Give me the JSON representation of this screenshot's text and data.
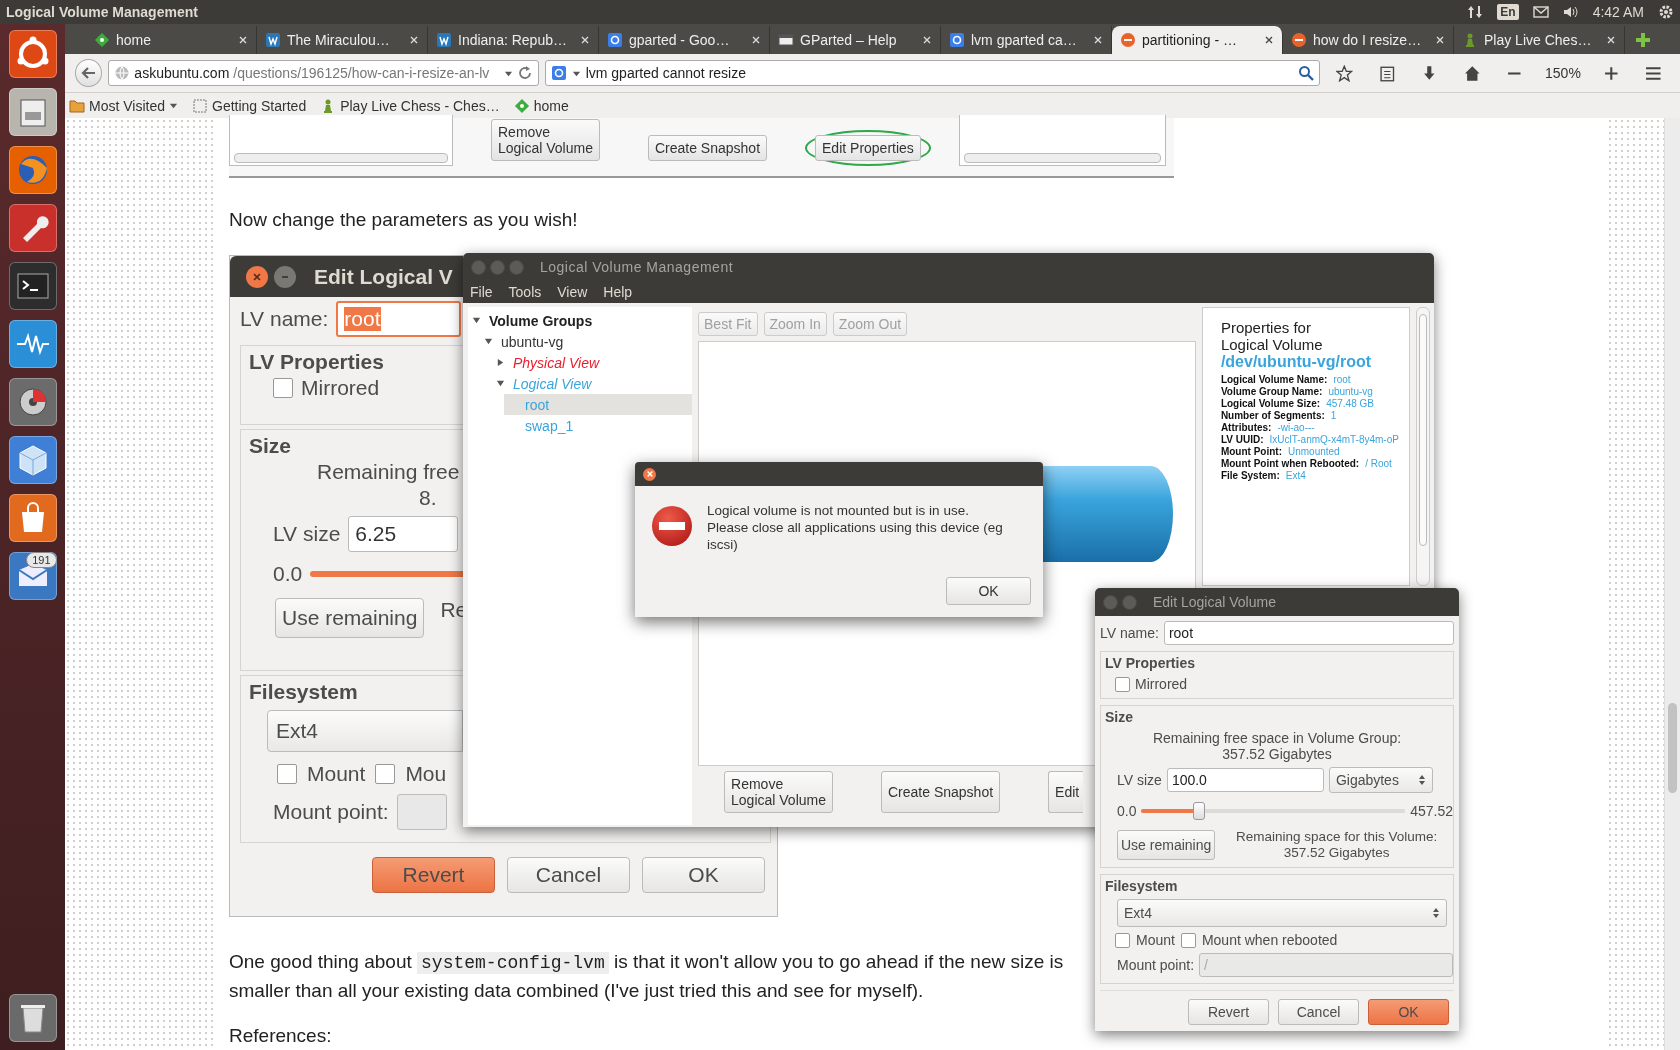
{
  "top_panel": {
    "title": "Logical Volume Management",
    "keyboard_layout": "En",
    "clock": "4:42 AM"
  },
  "launcher": {
    "mail_badge": "191"
  },
  "browser": {
    "tabs": [
      {
        "label": "home",
        "kind": "diamond",
        "selected": false
      },
      {
        "label": "The Miraculou…",
        "kind": "w-badge",
        "selected": false
      },
      {
        "label": "Indiana: Repub…",
        "kind": "w-badge",
        "selected": false
      },
      {
        "label": "gparted - Goo…",
        "kind": "g-badge",
        "selected": false
      },
      {
        "label": "GParted – Help",
        "kind": "window",
        "selected": false
      },
      {
        "label": "lvm gparted ca…",
        "kind": "g-badge",
        "selected": false
      },
      {
        "label": "partitioning - …",
        "kind": "bubble",
        "selected": true
      },
      {
        "label": "how do I resize…",
        "kind": "bubble",
        "selected": false
      },
      {
        "label": "Play Live Ches…",
        "kind": "pawn",
        "selected": false
      }
    ],
    "address": {
      "host": "askubuntu.com",
      "path": "/questions/196125/how-can-i-resize-an-lv"
    },
    "search": {
      "value": "lvm gparted cannot resize"
    },
    "zoom_level": "150%",
    "bookmarks": [
      {
        "label": "Most Visited",
        "kind": "folder-menu"
      },
      {
        "label": "Getting Started",
        "kind": "page"
      },
      {
        "label": "Play Live Chess - Ches…",
        "kind": "pawn"
      },
      {
        "label": "home",
        "kind": "diamond"
      }
    ]
  },
  "page": {
    "top_image": {
      "buttons": [
        {
          "label": "Remove\nLogical Volume",
          "circled": false
        },
        {
          "label": "Create Snapshot",
          "circled": false
        },
        {
          "label": "Edit Properties",
          "circled": true
        }
      ]
    },
    "intro": "Now change the parameters as you wish!",
    "screenshot": {
      "title": "Edit Logical V",
      "lv_name_label": "LV name:",
      "lv_name": "root",
      "properties_title": "LV Properties",
      "mirrored": {
        "label": "Mirrored",
        "checked": false
      },
      "size_title": "Size",
      "remaining": "Remaining free",
      "remaining_value": "8.",
      "lv_size_label": "LV size",
      "lv_size": "6.25",
      "min": "0.0",
      "use_remaining": "Use remaining",
      "remaining_volume": "Re",
      "filesystem_title": "Filesystem",
      "filesystem": "Ext4",
      "mount": {
        "label": "Mount",
        "checked": false
      },
      "mount_rebooted": {
        "label": "Mou",
        "checked": false
      },
      "mount_point_label": "Mount point:",
      "buttons": [
        {
          "label": "Revert",
          "default": true
        },
        {
          "label": "Cancel",
          "default": false
        },
        {
          "label": "OK",
          "default": false
        }
      ]
    },
    "paragraph": {
      "before": "One good thing about ",
      "code": "system-config-lvm",
      "after": " is that it won't allow you to go ahead if the new size is smaller than all your existing data combined (I've just tried this and see for myself)."
    },
    "references_heading": "References:"
  },
  "lvm_window": {
    "title": "Logical Volume Management",
    "menu": [
      "File",
      "Tools",
      "View",
      "Help"
    ],
    "tree": [
      {
        "label": "Volume Groups",
        "kind": "heading",
        "expanded": true,
        "selected": false,
        "children": [
          {
            "label": "ubuntu-vg",
            "kind": "group",
            "expanded": true,
            "selected": false,
            "children": [
              {
                "label": "Physical View",
                "kind": "physical",
                "expanded": false,
                "selected": false
              },
              {
                "label": "Logical View",
                "kind": "logical",
                "expanded": true,
                "selected": false,
                "children": [
                  {
                    "label": "root",
                    "kind": "volume",
                    "selected": true
                  },
                  {
                    "label": "swap_1",
                    "kind": "volume",
                    "selected": false
                  }
                ]
              }
            ]
          }
        ]
      }
    ],
    "toolbar": [
      {
        "label": "Best Fit",
        "disabled": true
      },
      {
        "label": "Zoom In",
        "disabled": true
      },
      {
        "label": "Zoom Out",
        "disabled": true
      }
    ],
    "properties": {
      "heading": "Properties for\nLogical Volume",
      "path": "/dev/ubuntu-vg/root",
      "fields": [
        {
          "label": "Logical Volume Name:",
          "value": "root"
        },
        {
          "label": "Volume Group Name:",
          "value": "ubuntu-vg"
        },
        {
          "label": "Logical Volume Size:",
          "value": "457.48 GB"
        },
        {
          "label": "Number of Segments:",
          "value": "1"
        },
        {
          "label": "Attributes:",
          "value": "-wi-ao---"
        },
        {
          "label": "LV UUID:",
          "value": "IxUclT-anmQ-x4mT-8y4m-oP"
        },
        {
          "label": "Mount Point:",
          "value": "Unmounted"
        },
        {
          "label": "Mount Point when Rebooted:",
          "value": "/  Root"
        },
        {
          "label": "File System:",
          "value": "Ext4"
        }
      ]
    },
    "buttons": [
      "Remove\nLogical Volume",
      "Create Snapshot",
      "Edit"
    ]
  },
  "error_dialog": {
    "message": "Logical volume is not mounted but is in use.\nPlease close all applications using this device (eg\niscsi)",
    "button": "OK"
  },
  "edit_dialog": {
    "title": "Edit Logical Volume",
    "lv_name_label": "LV name:",
    "lv_name": "root",
    "properties_title": "LV Properties",
    "mirrored": {
      "label": "Mirrored",
      "checked": false
    },
    "size_title": "Size",
    "remaining": "Remaining free space in Volume Group:\n357.52 Gigabytes",
    "lv_size_label": "LV size",
    "lv_size": "100.0",
    "unit": "Gigabytes",
    "min": "0.0",
    "max": "457.52",
    "level": 0.2186,
    "use_remaining": "Use remaining",
    "remaining_volume": "Remaining space for this Volume:\n357.52 Gigabytes",
    "filesystem_title": "Filesystem",
    "filesystem": "Ext4",
    "mount": {
      "label": "Mount",
      "checked": false
    },
    "mount_rebooted": {
      "label": "Mount when rebooted",
      "checked": false
    },
    "mount_point_label": "Mount point:",
    "mount_point": "/",
    "mount_point_disabled": true,
    "buttons": [
      {
        "label": "Revert",
        "default": false
      },
      {
        "label": "Cancel",
        "default": false
      },
      {
        "label": "OK",
        "default": true
      }
    ]
  }
}
